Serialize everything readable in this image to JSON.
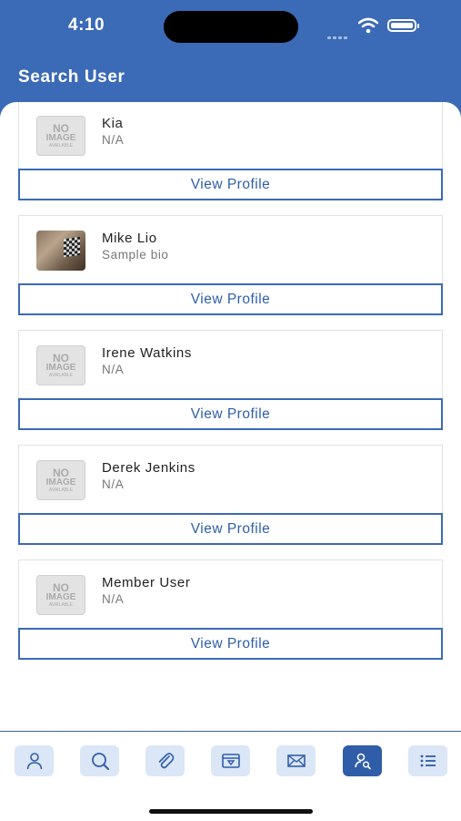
{
  "status": {
    "time": "4:10"
  },
  "header": {
    "title": "Search User"
  },
  "list": {
    "view_profile_label": "View Profile",
    "users": [
      {
        "name": "Kia",
        "bio": "N/A",
        "avatar": "no-image"
      },
      {
        "name": "Mike Lio",
        "bio": "Sample bio",
        "avatar": "photo"
      },
      {
        "name": "Irene Watkins",
        "bio": "N/A",
        "avatar": "no-image"
      },
      {
        "name": "Derek Jenkins",
        "bio": "N/A",
        "avatar": "no-image"
      },
      {
        "name": "Member User",
        "bio": "N/A",
        "avatar": "no-image"
      }
    ]
  },
  "placeholder_image": {
    "line1": "NO",
    "line2": "IMAGE",
    "line3": "AVAILABLE"
  },
  "tabbar": {
    "items": [
      {
        "icon": "person-icon",
        "active": false
      },
      {
        "icon": "search-icon",
        "active": false
      },
      {
        "icon": "paperclip-icon",
        "active": false
      },
      {
        "icon": "ticket-icon",
        "active": false
      },
      {
        "icon": "mail-icon",
        "active": false
      },
      {
        "icon": "user-search-icon",
        "active": true
      },
      {
        "icon": "list-icon",
        "active": false
      }
    ]
  },
  "colors": {
    "primary": "#3b6ab6",
    "tab_bg": "#dbe6f7",
    "tab_active": "#2f5da8"
  }
}
